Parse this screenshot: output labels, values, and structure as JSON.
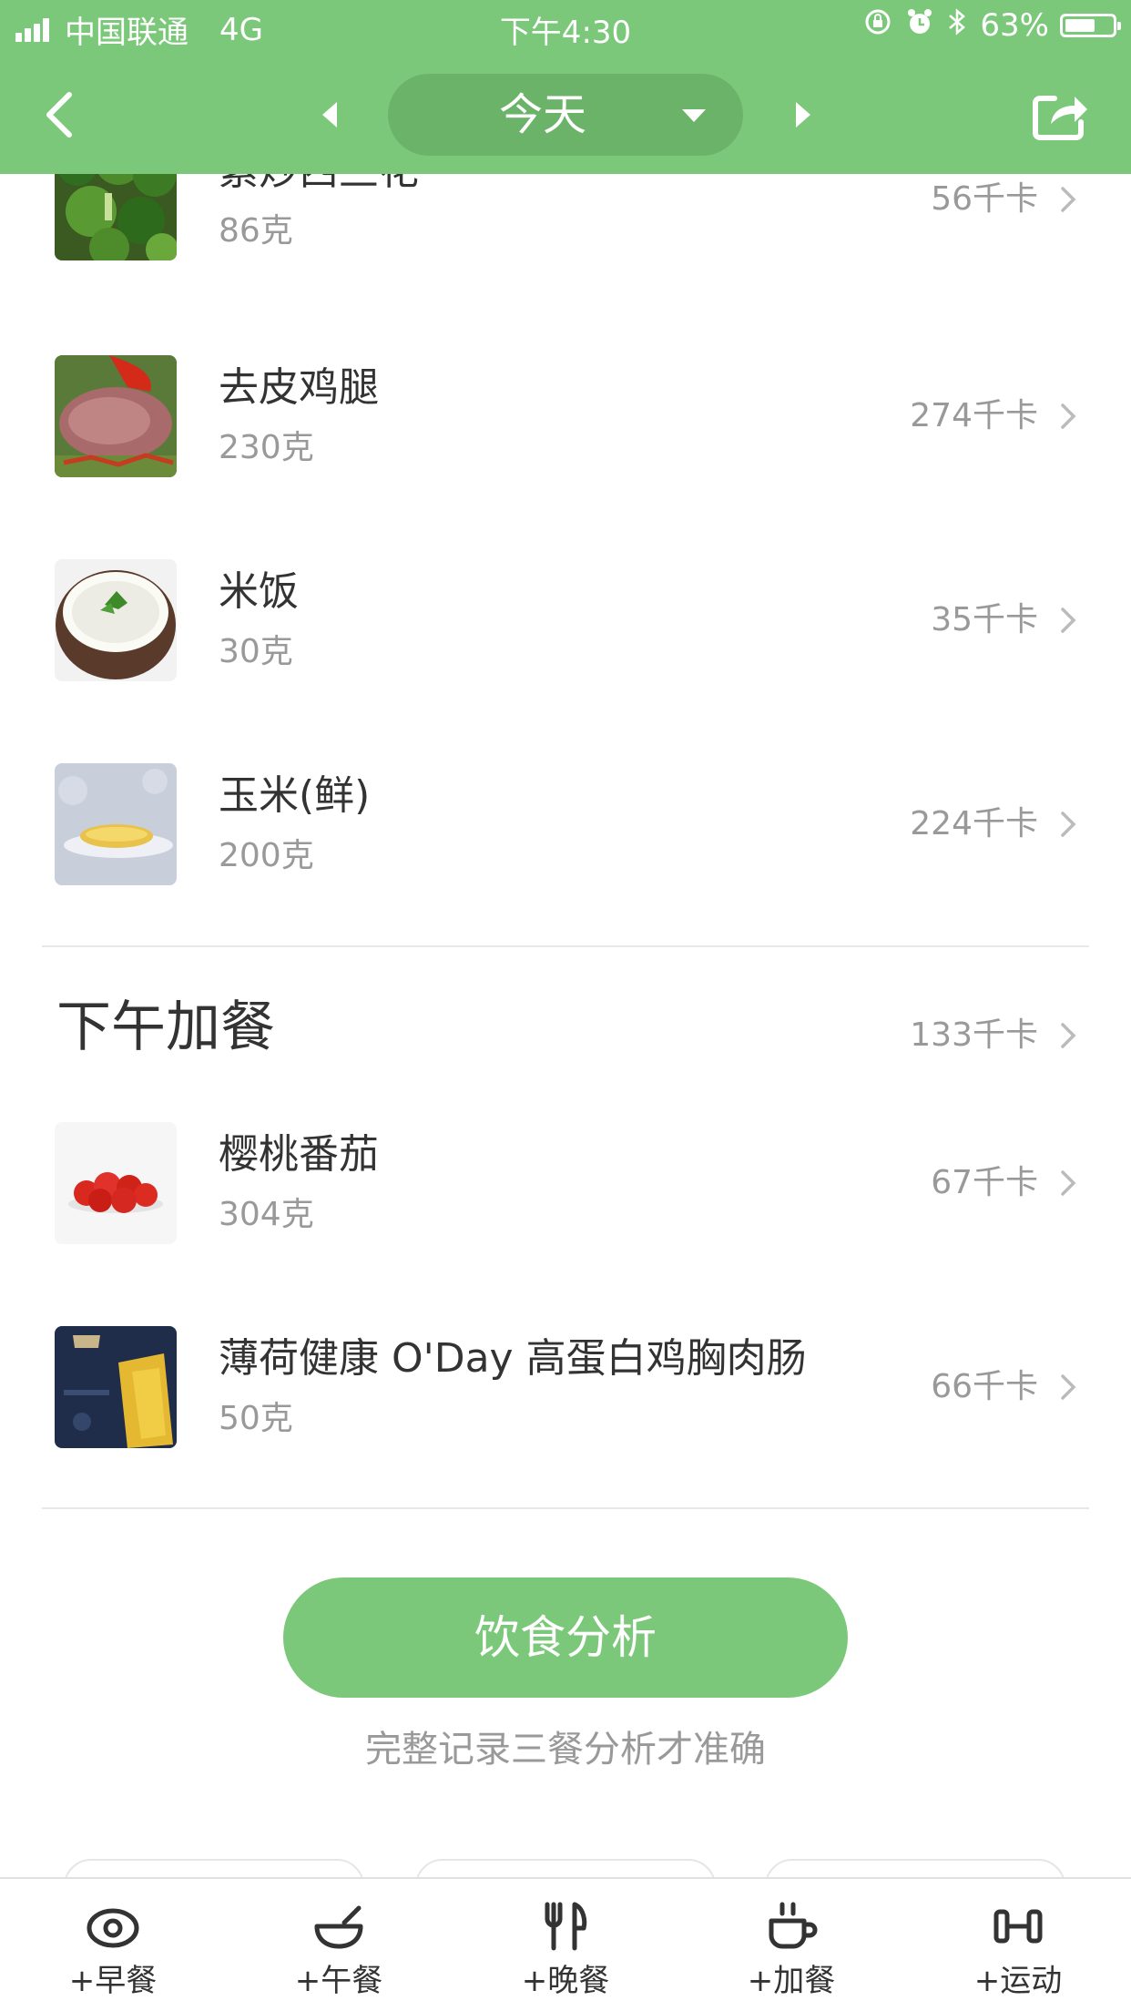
{
  "status_bar": {
    "carrier": "中国联通",
    "network": "4G",
    "time": "下午4:30",
    "battery": "63%",
    "battery_level": 0.63
  },
  "nav": {
    "back_icon": "chevron-left-icon",
    "prev_icon": "triangle-left-icon",
    "next_icon": "triangle-right-icon",
    "date_label": "今天",
    "dropdown_icon": "caret-down-icon",
    "share_icon": "share-icon"
  },
  "food_list": [
    {
      "name": "素炒西兰花",
      "weight": "86克",
      "kcal": "56千卡",
      "thumb": "broccoli-photo"
    },
    {
      "name": "去皮鸡腿",
      "weight": "230克",
      "kcal": "274千卡",
      "thumb": "chicken-leg-photo"
    },
    {
      "name": "米饭",
      "weight": "30克",
      "kcal": "35千卡",
      "thumb": "rice-bowl-photo"
    },
    {
      "name": "玉米(鲜)",
      "weight": "200克",
      "kcal": "224千卡",
      "thumb": "corn-photo"
    }
  ],
  "snack_section": {
    "title": "下午加餐",
    "kcal": "133千卡",
    "items": [
      {
        "name": "樱桃番茄",
        "weight": "304克",
        "kcal": "67千卡",
        "thumb": "cherry-tomato-photo"
      },
      {
        "name": "薄荷健康 O'Day 高蛋白鸡胸肉肠",
        "weight": "50克",
        "kcal": "66千卡",
        "thumb": "sausage-package-photo"
      }
    ]
  },
  "analysis": {
    "button_label": "饮食分析",
    "hint": "完整记录三餐分析才准确"
  },
  "tab_bar": [
    {
      "label": "+早餐",
      "icon": "egg-icon"
    },
    {
      "label": "+午餐",
      "icon": "bowl-icon"
    },
    {
      "label": "+晚餐",
      "icon": "fork-knife-icon"
    },
    {
      "label": "+加餐",
      "icon": "coffee-cup-icon"
    },
    {
      "label": "+运动",
      "icon": "dumbbell-icon"
    }
  ],
  "colors": {
    "brand_green": "#7cc87a",
    "pill_green": "#6bb369",
    "text_dark": "#333333",
    "text_muted": "#999999"
  }
}
